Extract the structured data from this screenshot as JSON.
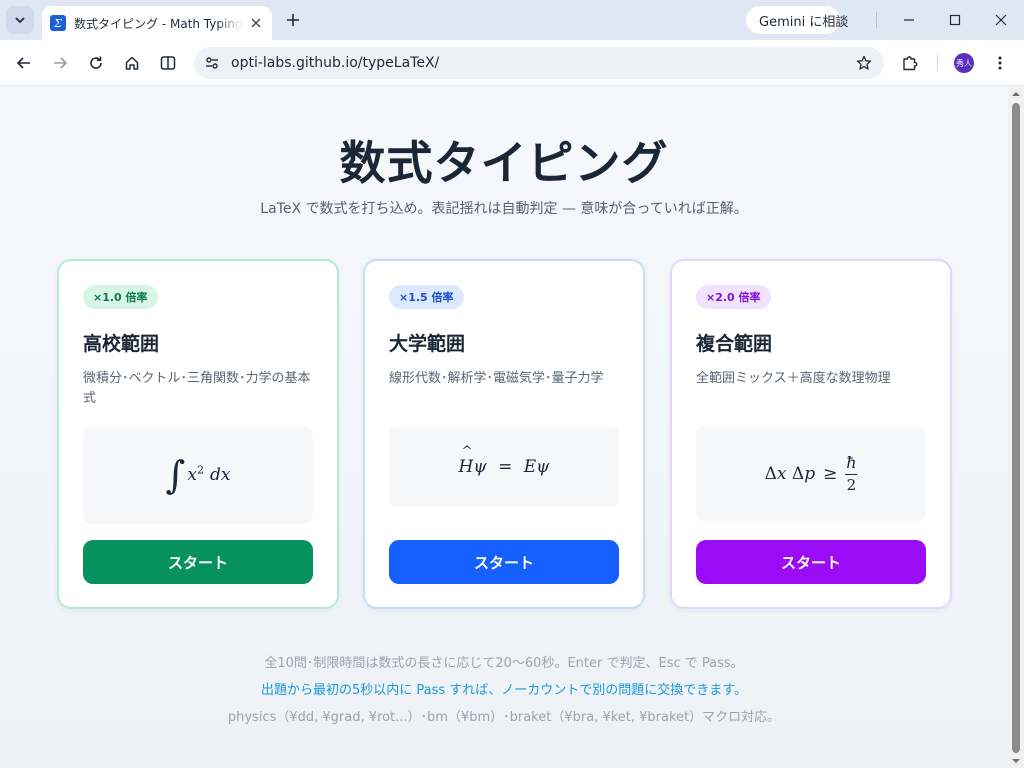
{
  "browser": {
    "tab_title": "数式タイピング - Math Typing Game",
    "favicon_glyph": "Σ",
    "gemini_label": "Gemini に相談",
    "url": "opti-labs.github.io/typeLaTeX/",
    "avatar_text": "秀人"
  },
  "page": {
    "title": "数式タイピング",
    "subtitle": "LaTeX で数式を打ち込め。表記揺れは自動判定 — 意味が合っていれば正解。"
  },
  "cards": [
    {
      "badge": "×1.0 倍率",
      "title": "高校範囲",
      "desc": "微積分･ベクトル･三角関数･力学の基本式",
      "button": "スタート",
      "accent": "#07915f",
      "border": "#b4ecd3",
      "badge_bg": "#d7f5e7",
      "badge_fg": "#0b7a4c"
    },
    {
      "badge": "×1.5 倍率",
      "title": "大学範囲",
      "desc": "線形代数･解析学･電磁気学･量子力学",
      "button": "スタート",
      "accent": "#1560ff",
      "border": "#c6dcfb",
      "badge_bg": "#dbe8fd",
      "badge_fg": "#1d4fc9"
    },
    {
      "badge": "×2.0 倍率",
      "title": "複合範囲",
      "desc": "全範囲ミックス＋高度な数理物理",
      "button": "スタート",
      "accent": "#9b0cf6",
      "border": "#e6d5fb",
      "badge_bg": "#f1e2fd",
      "badge_fg": "#8413d6"
    }
  ],
  "footer": {
    "line1": "全10問･制限時間は数式の長さに応じて20〜60秒。Enter で判定、Esc で Pass。",
    "line2": "出題から最初の5秒以内に Pass すれば、ノーカウントで別の問題に交換できます。",
    "line3": "physics（¥dd, ¥grad, ¥rot...）･bm（¥bm）･braket（¥bra, ¥ket, ¥braket）マクロ対応。"
  }
}
